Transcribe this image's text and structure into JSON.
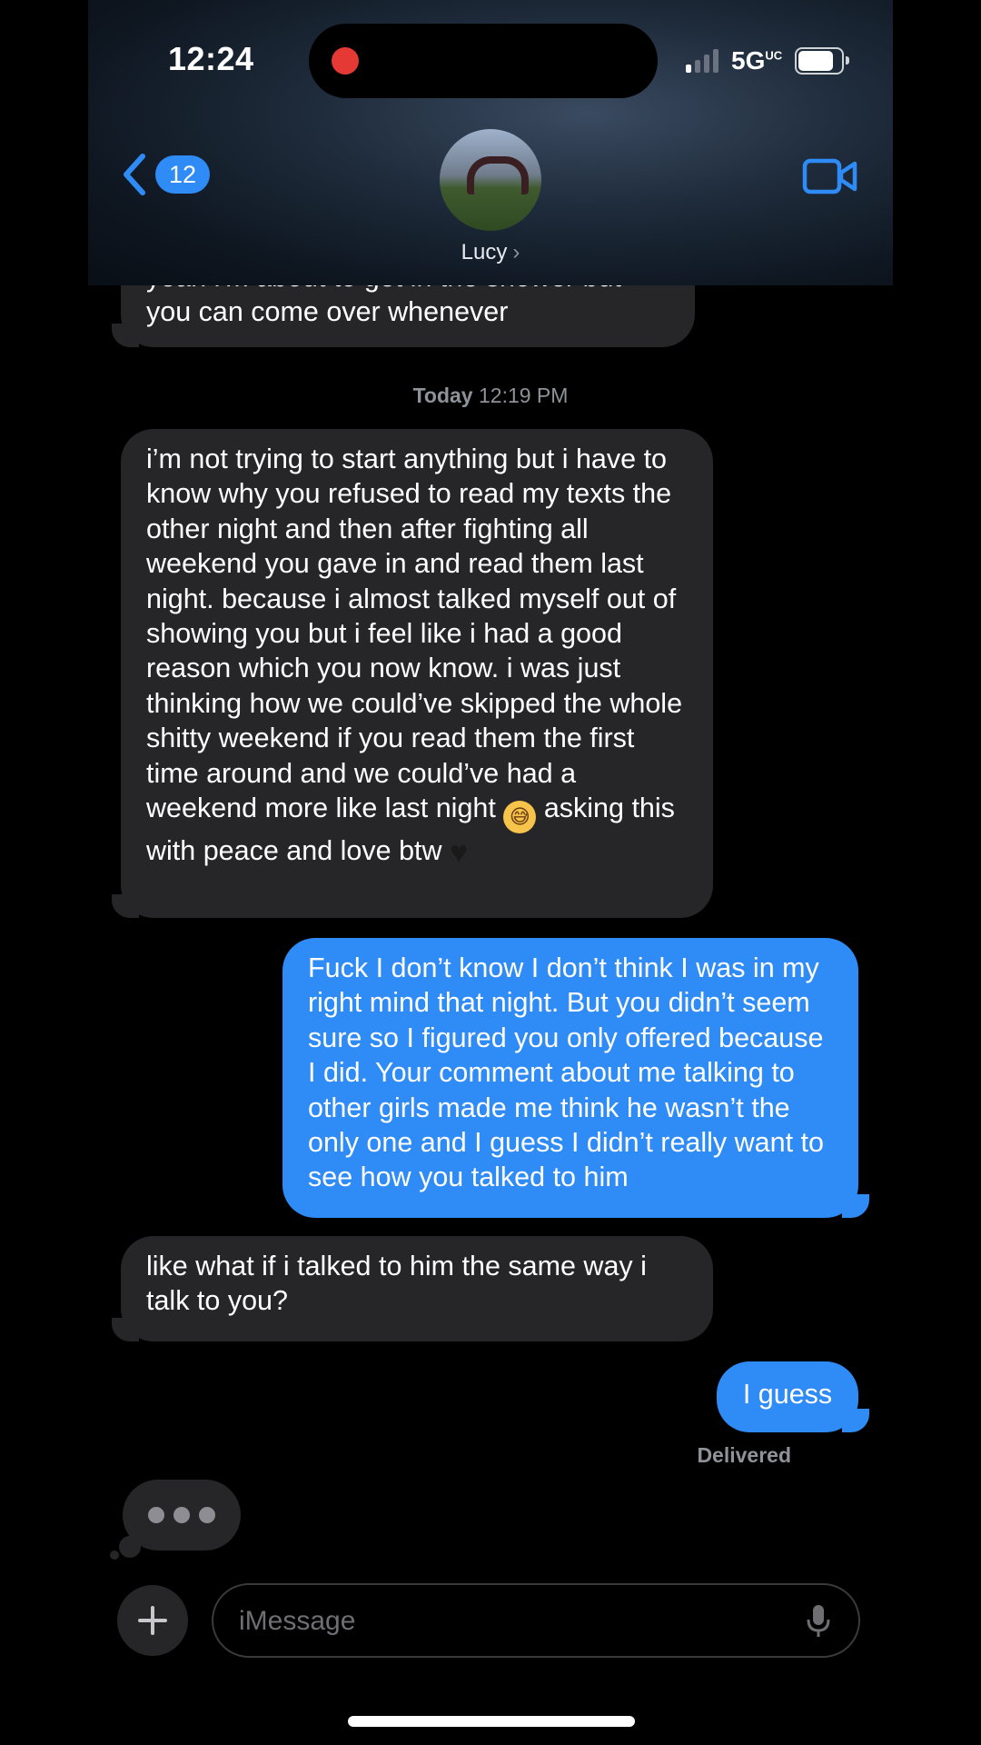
{
  "status_bar": {
    "time": "12:24",
    "network": "5G",
    "network_sup": "UC"
  },
  "nav": {
    "back_count": "12",
    "contact_name": "Lucy"
  },
  "messages": {
    "clipped": "yeah i'm about to get in the shower but you can come over whenever",
    "timestamp_day": "Today",
    "timestamp_time": "12:19 PM",
    "m1_a": "i’m not trying to start anything but i have to know why you refused to read my texts the other night and then after fighting all weekend you gave in and read them last night. because i almost talked myself out of showing you but i feel like i had a good reason which you now know. i was just thinking how we could’ve skipped the whole shitty weekend if you read them the first time around and we could’ve had a weekend more like last night",
    "m1_emoji": "😅",
    "m1_b": "asking this with peace and love btw",
    "m1_heart": "♥",
    "m2": "Fuck I don’t know I don’t think I was in my right mind that night. But you didn’t seem sure so I figured you only offered because I did. Your comment about me talking to other girls made me think he wasn’t the only one and I guess I didn’t really want to see how you talked to him",
    "m3": "like what if i talked to him the same way i talk to you?",
    "m4": "I guess",
    "delivered": "Delivered"
  },
  "composer": {
    "placeholder": "iMessage"
  },
  "colors": {
    "outgoing": "#2f8bf5",
    "incoming": "#262629",
    "accent": "#2f8bf5"
  },
  "icons": [
    "back-chevron-icon",
    "video-camera-icon",
    "plus-icon",
    "microphone-icon"
  ]
}
